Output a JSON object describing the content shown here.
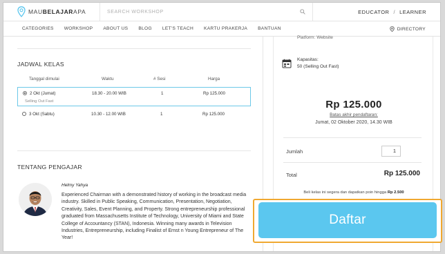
{
  "header": {
    "logo_text_1": "MAU",
    "logo_text_2": "BELAJAR",
    "logo_text_3": "APA",
    "search_placeholder": "SEARCH WORKSHOP",
    "educator_label": "EDUCATOR",
    "separator": "/",
    "learner_label": "LEARNER"
  },
  "nav": {
    "items": [
      "CATEGORIES",
      "WORKSHOP",
      "ABOUT US",
      "BLOG",
      "LET'S TEACH",
      "KARTU PRAKERJA",
      "BANTUAN"
    ],
    "directory_label": "DIRECTORY"
  },
  "schedule": {
    "title": "JADWAL KELAS",
    "columns": [
      "Tanggal dimulai",
      "Waktu",
      "# Sesi",
      "Harga"
    ],
    "rows": [
      {
        "date": "2 Okt (Jumat)",
        "time": "18.30 - 20.00 WIB",
        "sessions": "1",
        "price": "Rp 125.000",
        "note": "Selling Out Fast",
        "selected": true
      },
      {
        "date": "3 Okt (Sabtu)",
        "time": "10.30 - 12.00 WIB",
        "sessions": "1",
        "price": "Rp 125.000",
        "note": "",
        "selected": false
      }
    ]
  },
  "teacher": {
    "title": "TENTANG PENGAJAR",
    "name": "Helmy Yahya",
    "bio": "Experienced Chairman with a demonstrated history of working in the broadcast media industry. Skilled in Public Speaking, Communication, Presentation, Negotiation, Creativity, Sales, Event Planning, and Property. Strong entrepreneurship professional graduated from Massachusetts Institute of Technology, University of Miami and State College of Accountancy (STAN), Indonesia. Winning many awards in Television Industries, Entrepreneurship, including Finalist of Ernst n Young Entrepreneur of The Year!"
  },
  "sidebar": {
    "platform_text": "Platform: Website",
    "capacity_label": "Kapasitas:",
    "capacity_value": "50 (Selling Out Fast)",
    "price": "Rp 125.000",
    "deadline_label": "Batas akhir pendaftaran:",
    "deadline_value": "Jumat, 02 Oktober 2020, 14.30 WIB",
    "quantity_label": "Jumlah",
    "quantity_value": "1",
    "total_label": "Total",
    "total_value": "Rp 125.000",
    "points_note_1": "Beli kelas ini segera dan dapatkan poin hingga ",
    "points_note_2": "Rp 2.500"
  },
  "cta": {
    "label": "Daftar",
    "button_color": "#5bc7ef",
    "highlight_color": "#f0a830"
  }
}
